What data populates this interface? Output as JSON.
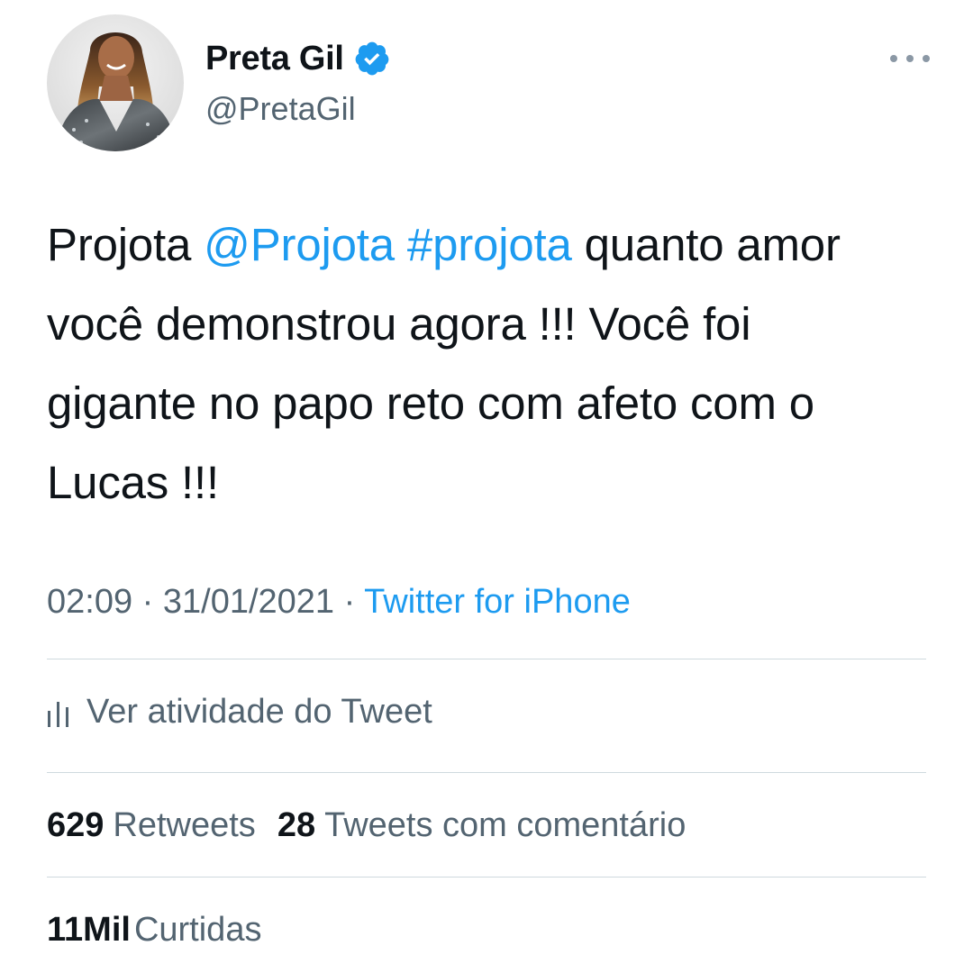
{
  "author": {
    "display_name": "Preta Gil",
    "handle": "@PretaGil",
    "verified_icon": "verified-badge-icon",
    "avatar": "profile-photo"
  },
  "tweet": {
    "text_start": "Projota ",
    "mention": "@Projota",
    "space1": " ",
    "hashtag": "#projota",
    "text_end": " quanto amor você demonstrou agora !!! Você foi gigante no papo reto com afeto com o Lucas !!!"
  },
  "meta": {
    "time": "02:09",
    "separator": " · ",
    "date": "31/01/2021",
    "source": "Twitter for iPhone"
  },
  "activity": {
    "label": "Ver atividade do Tweet",
    "icon": "analytics-icon"
  },
  "stats": {
    "retweets_count": "629",
    "retweets_label": "Retweets",
    "quotes_count": "28",
    "quotes_label": "Tweets com comentário",
    "likes_count": "11Mil",
    "likes_label": "Curtidas"
  },
  "colors": {
    "link": "#1d9bf0",
    "secondary_text": "#536471",
    "primary_text": "#0f1419",
    "divider": "#cfd9de"
  }
}
